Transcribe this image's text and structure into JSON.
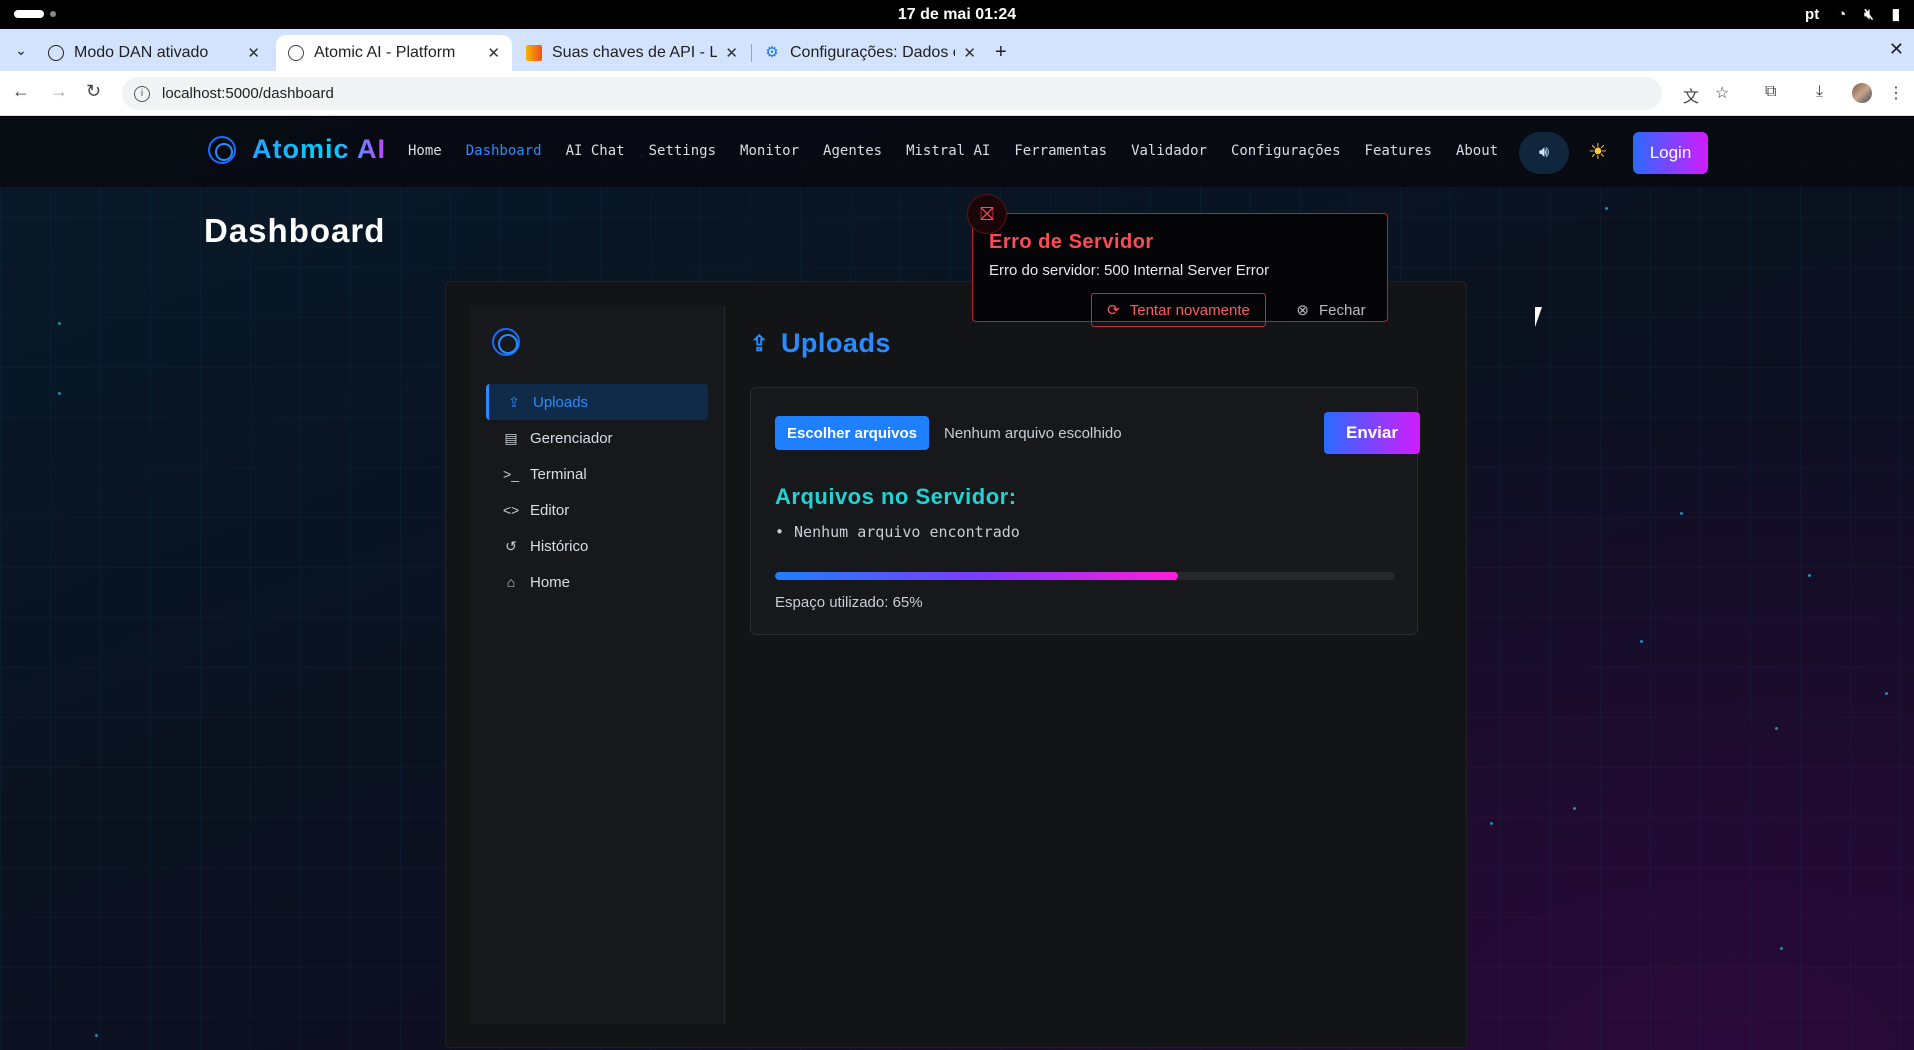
{
  "os": {
    "clock": "17 de mai  01:24",
    "lang": "pt",
    "wifi_icon": "wifi-icon",
    "volume_icon": "volume-muted-icon",
    "battery_icon": "battery-icon"
  },
  "browser": {
    "tabs": [
      {
        "title": "Modo DAN ativado",
        "favicon": "openai-icon"
      },
      {
        "title": "Atomic AI - Platform",
        "favicon": "globe-icon"
      },
      {
        "title": "Suas chaves de API - L",
        "favicon": "mistral-icon"
      },
      {
        "title": "Configurações: Dados c",
        "favicon": "gear-icon"
      }
    ],
    "active_tab": 1,
    "url": "localhost:5000/dashboard"
  },
  "site": {
    "brand": "Atomic AI",
    "nav": [
      "Home",
      "Dashboard",
      "AI Chat",
      "Settings",
      "Monitor",
      "Agentes",
      "Mistral AI",
      "Ferramentas",
      "Validador",
      "Configurações",
      "Features",
      "About"
    ],
    "active_nav": "Dashboard",
    "login": "Login",
    "accent": "#2a8bff"
  },
  "page": {
    "title": "Dashboard"
  },
  "sidebar": {
    "items": [
      {
        "label": "Uploads",
        "icon": "upload-icon",
        "active": true
      },
      {
        "label": "Gerenciador",
        "icon": "file-icon",
        "active": false
      },
      {
        "label": "Terminal",
        "icon": "terminal-icon",
        "active": false
      },
      {
        "label": "Editor",
        "icon": "code-icon",
        "active": false
      },
      {
        "label": "Histórico",
        "icon": "history-icon",
        "active": false
      },
      {
        "label": "Home",
        "icon": "home-icon",
        "active": false
      }
    ]
  },
  "uploads": {
    "title": "Uploads",
    "choose_label": "Escolher arquivos",
    "no_file": "Nenhum arquivo escolhido",
    "send_label": "Enviar",
    "files_title": "Arquivos no Servidor:",
    "files": [
      "Nenhum arquivo encontrado"
    ],
    "usage_text": "Espaço utilizado: 65%",
    "usage_fraction": 0.65
  },
  "error_toast": {
    "title": "Erro de Servidor",
    "message": "Erro do servidor: 500 Internal Server Error",
    "retry_label": "Tentar novamente",
    "close_label": "Fechar",
    "color": "#ff4a55"
  }
}
